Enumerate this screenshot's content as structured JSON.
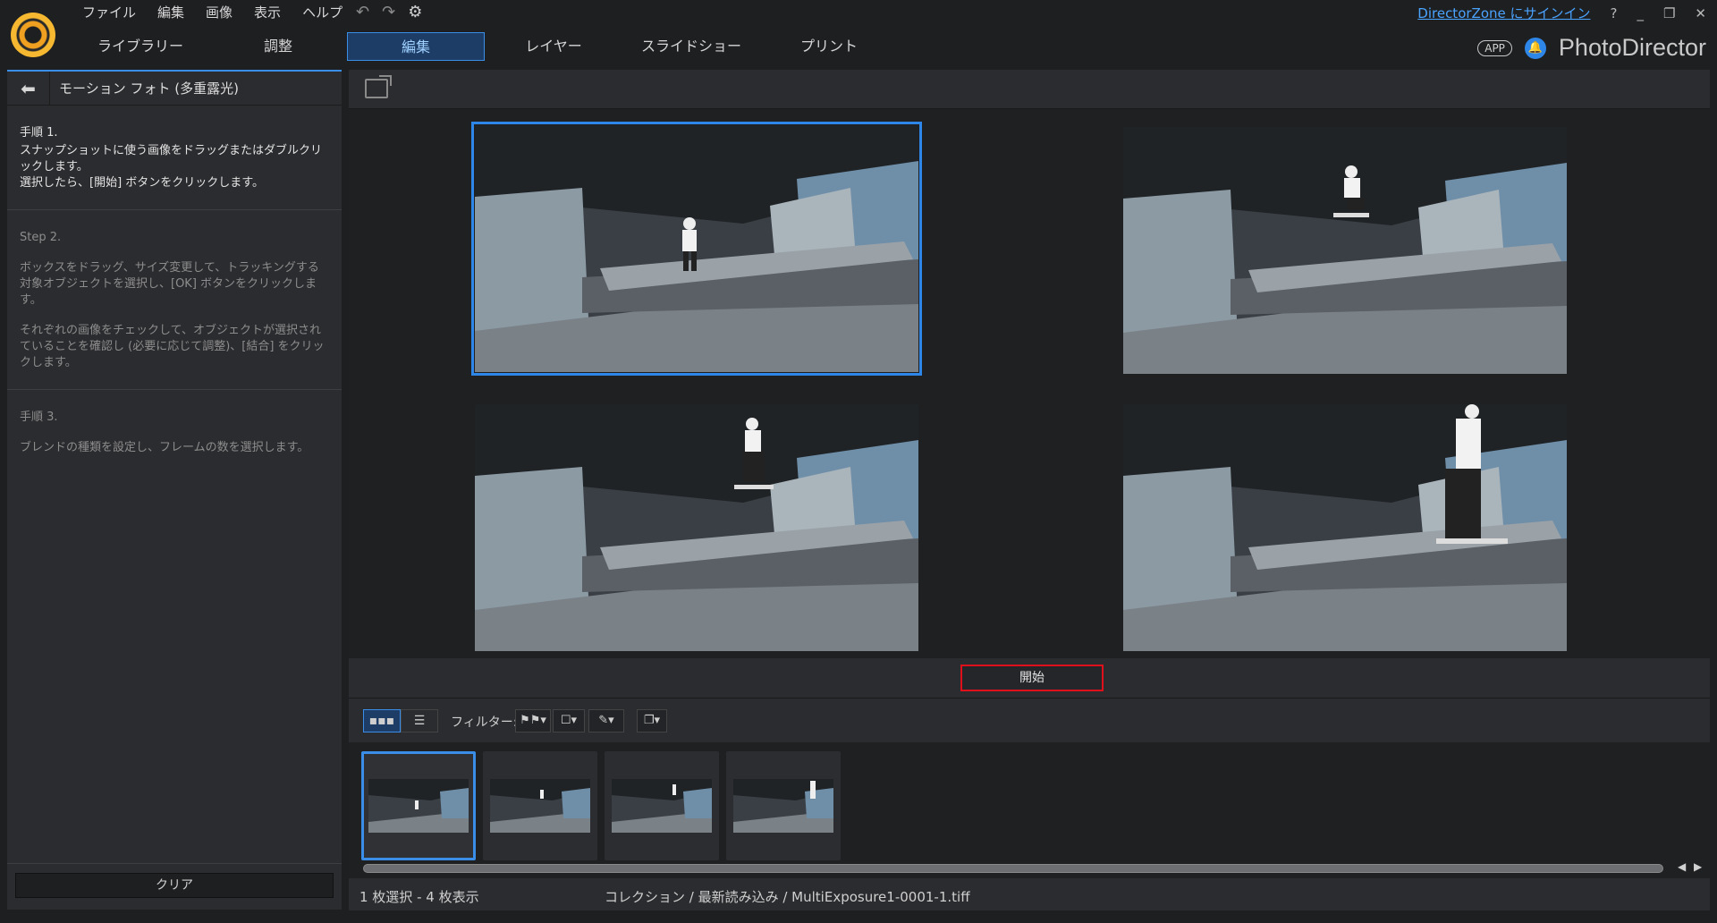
{
  "menu": [
    "ファイル",
    "編集",
    "画像",
    "表示",
    "ヘルプ"
  ],
  "quick_actions": {
    "undo": "↶",
    "redo": "↷",
    "settings": "⚙"
  },
  "top_right": {
    "signin": "DirectorZone にサインイン",
    "help": "?",
    "minimize": "_",
    "restore": "❐",
    "close": "✕"
  },
  "tabs": [
    {
      "label": "ライブラリー",
      "active": false
    },
    {
      "label": "調整",
      "active": false
    },
    {
      "label": "編集",
      "active": true
    },
    {
      "label": "レイヤー",
      "active": false
    },
    {
      "label": "スライドショー",
      "active": false
    },
    {
      "label": "プリント",
      "active": false
    }
  ],
  "brand": {
    "app_badge": "APP",
    "name": "PhotoDirector"
  },
  "left_panel": {
    "back_icon": "⬅",
    "title": "モーション フォト (多重露光)",
    "steps": [
      {
        "heading": "手順 1.",
        "paragraphs": [
          "スナップショットに使う画像をドラッグまたはダブルクリックします。",
          "選択したら、[開始] ボタンをクリックします。"
        ]
      },
      {
        "heading": "Step 2.",
        "paragraphs": [
          "ボックスをドラッグ、サイズ変更して、トラッキングする対象オブジェクトを選択し、[OK] ボタンをクリックします。",
          "それぞれの画像をチェックして、オブジェクトが選択されていることを確認し (必要に応じて調整)、[結合] をクリックします。"
        ]
      },
      {
        "heading": "手順 3.",
        "paragraphs": [
          "ブレンドの種類を設定し、フレームの数を選択します。"
        ]
      }
    ],
    "clear_label": "クリア"
  },
  "main": {
    "start_label": "開始",
    "filter_label": "フィルター:",
    "filter_buttons": [
      "⚑⚑▾",
      "☐▾",
      "✎▾",
      "❐▾"
    ],
    "view_buttons": [
      "▪▪▪",
      "☰"
    ]
  },
  "status": {
    "selection": "1 枚選択 - 4 枚表示",
    "path": "コレクション / 最新読み込み / MultiExposure1-0001-1.tiff"
  },
  "scroll": {
    "left": "◀",
    "right": "▶"
  }
}
